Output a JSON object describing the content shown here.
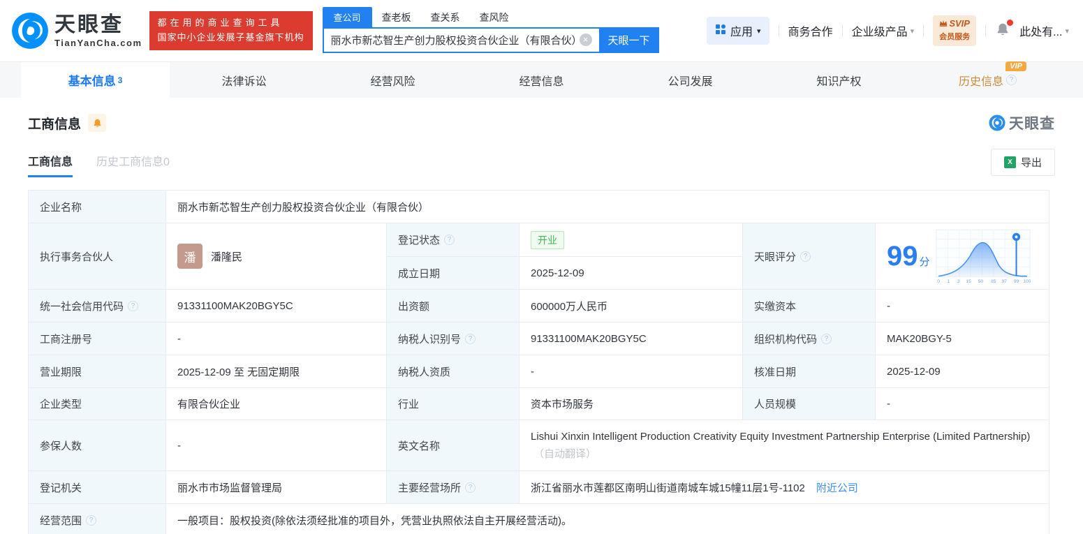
{
  "icons": {
    "help": "?",
    "caret": "▾",
    "clear": "×",
    "excel_x": "X"
  },
  "colors": {
    "primary": "#2181f0",
    "brand_red": "#dc3b2f",
    "vip_orange": "#f3a842",
    "open_green": "#3db550"
  },
  "header": {
    "logo": {
      "title": "天眼查",
      "domain": "TianYanCha.com"
    },
    "promo": {
      "line1": "都在用的商业查询工具",
      "line2": "国家中小企业发展子基金旗下机构"
    },
    "search": {
      "tabs": [
        "查公司",
        "查老板",
        "查关系",
        "查风险"
      ],
      "value": "丽水市新芯智生产创力股权投资合伙企业（有限合伙）",
      "button": "天眼一下"
    },
    "nav": {
      "apps": "应用",
      "cooperation": "商务合作",
      "enterprise": "企业级产品",
      "svip_top": "SVIP",
      "svip_bottom": "会员服务",
      "profile": "此处有..."
    }
  },
  "nav_tabs": {
    "items": [
      {
        "label": "基本信息",
        "count": "3"
      },
      {
        "label": "法律诉讼"
      },
      {
        "label": "经营风险"
      },
      {
        "label": "经营信息"
      },
      {
        "label": "公司发展"
      },
      {
        "label": "知识产权"
      },
      {
        "label": "历史信息",
        "vip": "VIP"
      }
    ]
  },
  "section": {
    "title": "工商信息",
    "subtab_active": "工商信息",
    "subtab_history": "历史工商信息0",
    "export_label": "导出",
    "watermark": "天眼查"
  },
  "table": {
    "company_name_label": "企业名称",
    "company_name": "丽水市新芯智生产创力股权投资合伙企业（有限合伙）",
    "partner_label": "执行事务合伙人",
    "partner_avatar": "潘",
    "partner_name": "潘隆民",
    "reg_status_label": "登记状态",
    "reg_status": "开业",
    "establish_label": "成立日期",
    "establish_date": "2025-12-09",
    "score_label": "天眼评分",
    "score_value": "99",
    "score_unit": "分",
    "credit_code_label": "统一社会信用代码",
    "credit_code": "91331100MAK20BGY5C",
    "capital_label": "出资额",
    "capital": "600000万人民币",
    "paid_capital_label": "实缴资本",
    "paid_capital": "-",
    "reg_number_label": "工商注册号",
    "reg_number": "-",
    "taxpayer_id_label": "纳税人识别号",
    "taxpayer_id": "91331100MAK20BGY5C",
    "org_code_label": "组织机构代码",
    "org_code": "MAK20BGY-5",
    "business_term_label": "营业期限",
    "business_term": "2025-12-09 至 无固定期限",
    "taxpayer_quality_label": "纳税人资质",
    "taxpayer_quality": "-",
    "approval_date_label": "核准日期",
    "approval_date": "2025-12-09",
    "company_type_label": "企业类型",
    "company_type": "有限合伙企业",
    "industry_label": "行业",
    "industry": "资本市场服务",
    "staff_size_label": "人员规模",
    "staff_size": "-",
    "insured_label": "参保人数",
    "insured": "-",
    "english_name_label": "英文名称",
    "english_name": "Lishui Xinxin Intelligent Production Creativity Equity Investment Partnership Enterprise (Limited Partnership)",
    "english_name_note": "（自动翻译）",
    "registry_label": "登记机关",
    "registry": "丽水市市场监督管理局",
    "address_label": "主要经营场所",
    "address": "浙江省丽水市莲都区南明山街道南城车城15幢11层1号-1102",
    "nearby_link": "附近公司",
    "scope_label": "经营范围",
    "scope": "一般项目：股权投资(除依法须经批准的项目外，凭营业执照依法自主开展经营活动)。"
  },
  "score_chart": {
    "type": "area",
    "description": "天眼评分 score distribution bell curve with marker pin at company score",
    "ticks": [
      "0",
      "1",
      "3",
      "15",
      "50",
      "85",
      "97",
      "99",
      "100"
    ],
    "marker_value": 99,
    "x_range": [
      0,
      100
    ]
  }
}
